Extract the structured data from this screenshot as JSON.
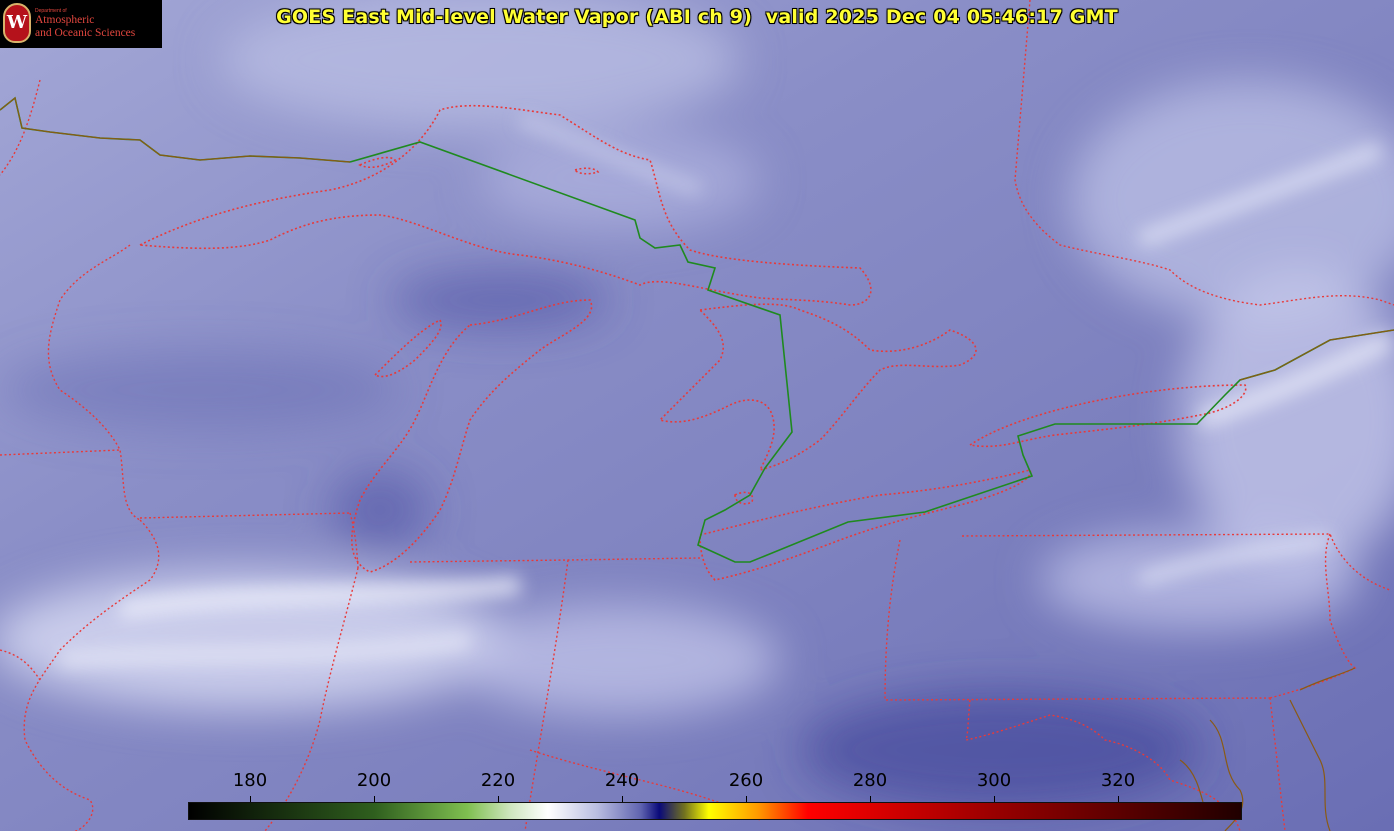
{
  "title": "GOES East Mid-level Water Vapor (ABI ch 9)  valid 2025 Dec 04 05:46:17 GMT",
  "logo": {
    "dept": "Department of",
    "line1": "Atmospheric",
    "line2": "and Oceanic Sciences",
    "seal_letter": "W"
  },
  "colorbar": {
    "min": 170,
    "max": 340,
    "ticks": [
      "180",
      "200",
      "220",
      "240",
      "260",
      "280",
      "300",
      "320"
    ],
    "stops": [
      {
        "value": 170,
        "color": "#000000"
      },
      {
        "value": 200,
        "color": "#2f5f1e"
      },
      {
        "value": 215,
        "color": "#7fbf50"
      },
      {
        "value": 222,
        "color": "#cfe6bf"
      },
      {
        "value": 228,
        "color": "#ffffff"
      },
      {
        "value": 236,
        "color": "#b9bde0"
      },
      {
        "value": 243,
        "color": "#6064b0"
      },
      {
        "value": 246,
        "color": "#0a0a7a"
      },
      {
        "value": 250,
        "color": "#707020"
      },
      {
        "value": 254,
        "color": "#ffff00"
      },
      {
        "value": 262,
        "color": "#ff9900"
      },
      {
        "value": 270,
        "color": "#ff0000"
      },
      {
        "value": 300,
        "color": "#9a0000"
      },
      {
        "value": 340,
        "color": "#200000"
      }
    ]
  },
  "colors": {
    "state_borders": "#e83a3a",
    "international_border": "#1f8a1f",
    "coastline": "#7a5a10",
    "title": "#ffff33"
  }
}
